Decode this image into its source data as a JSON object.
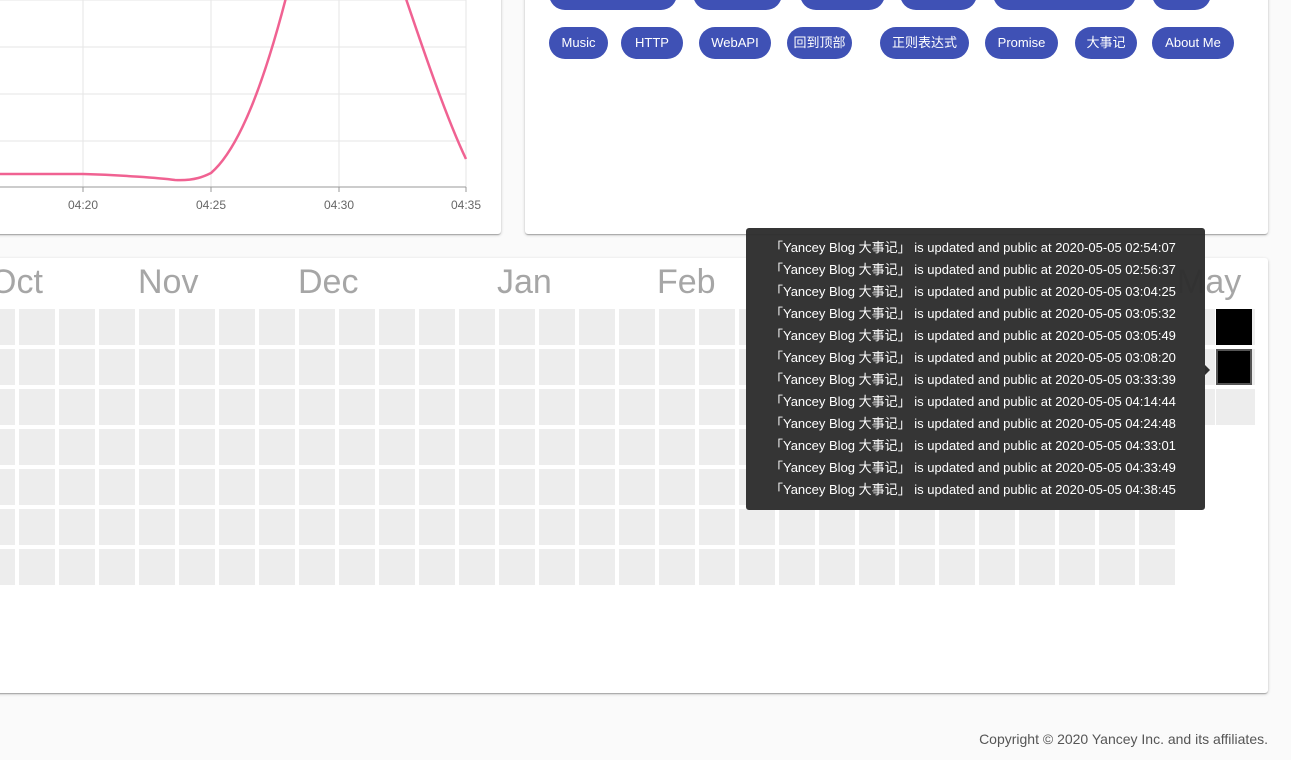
{
  "line_chart": {
    "x_ticks": [
      "04:20",
      "04:25",
      "04:30",
      "04:35"
    ],
    "color": "#f06292"
  },
  "tags": [
    {
      "label": "Music",
      "name": "tag-music"
    },
    {
      "label": "HTTP",
      "name": "tag-http"
    },
    {
      "label": "WebAPI",
      "name": "tag-webapi"
    },
    {
      "label": "回到顶部",
      "name": "tag-back-to-top"
    },
    {
      "label": "正则表达式",
      "name": "tag-regex"
    },
    {
      "label": "Promise",
      "name": "tag-promise"
    },
    {
      "label": "大事记",
      "name": "tag-milestones"
    },
    {
      "label": "About Me",
      "name": "tag-about-me"
    }
  ],
  "heatmap": {
    "months": [
      "Oct",
      "Nov",
      "Dec",
      "Jan",
      "Feb",
      "May"
    ],
    "empty_color": "#ededed",
    "active_color": "#000000"
  },
  "tooltip": {
    "lines": [
      "「Yancey Blog 大事记」 is updated and public at 2020-05-05 02:54:07",
      "「Yancey Blog 大事记」 is updated and public at 2020-05-05 02:56:37",
      "「Yancey Blog 大事记」 is updated and public at 2020-05-05 03:04:25",
      "「Yancey Blog 大事记」 is updated and public at 2020-05-05 03:05:32",
      "「Yancey Blog 大事记」 is updated and public at 2020-05-05 03:05:49",
      "「Yancey Blog 大事记」 is updated and public at 2020-05-05 03:08:20",
      "「Yancey Blog 大事记」 is updated and public at 2020-05-05 03:33:39",
      "「Yancey Blog 大事记」 is updated and public at 2020-05-05 04:14:44",
      "「Yancey Blog 大事记」 is updated and public at 2020-05-05 04:24:48",
      "「Yancey Blog 大事记」 is updated and public at 2020-05-05 04:33:01",
      "「Yancey Blog 大事记」 is updated and public at 2020-05-05 04:33:49",
      "「Yancey Blog 大事记」 is updated and public at 2020-05-05 04:38:45"
    ]
  },
  "footer": {
    "copyright": "Copyright © 2020 Yancey Inc. and its affiliates."
  }
}
